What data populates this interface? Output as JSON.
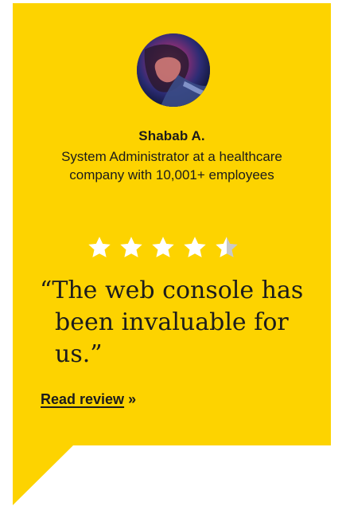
{
  "reviewer": {
    "name": "Shabab A.",
    "role": "System Administrator at a healthcare company with 10,001+ employees"
  },
  "rating": {
    "value": 4.5,
    "max": 5
  },
  "review": {
    "open_quote": "“",
    "text": "The web console has been invaluable for us.",
    "close_quote": "”"
  },
  "link": {
    "label": "Read review",
    "suffix": "»"
  },
  "colors": {
    "card_background": "#fdd300",
    "text": "#1c1c1c",
    "star_filled": "#ffffff",
    "star_empty": "#c9c9c9"
  },
  "icons": {
    "avatar": "reviewer-avatar-photo",
    "star": "star-icon"
  }
}
